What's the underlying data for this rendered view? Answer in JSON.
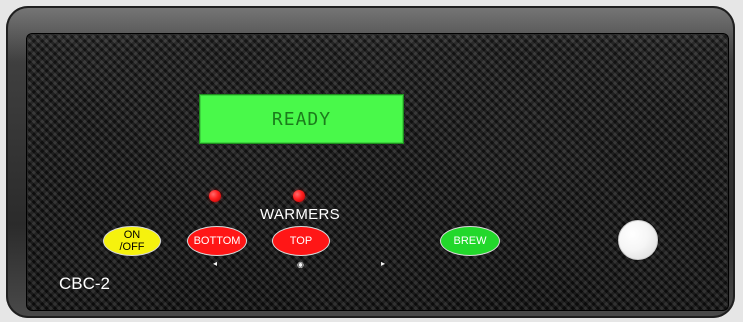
{
  "display": {
    "status": "READY"
  },
  "labels": {
    "warmers": "WARMERS",
    "model": "CBC-2"
  },
  "buttons": {
    "on_off": "ON /OFF",
    "bottom": "BOTTOM",
    "top": "TOP",
    "brew": "BREW"
  },
  "icons": {
    "left": "left-arrow-icon",
    "center": "center-dot-icon",
    "right": "right-arrow-icon",
    "knob": "round-knob-icon"
  },
  "colors": {
    "display_bg": "#49f94a",
    "display_text": "#1b7c1c",
    "on_off": "#f5f20e",
    "bottom": "#ff1616",
    "top": "#ff1616",
    "brew": "#22d82b"
  }
}
